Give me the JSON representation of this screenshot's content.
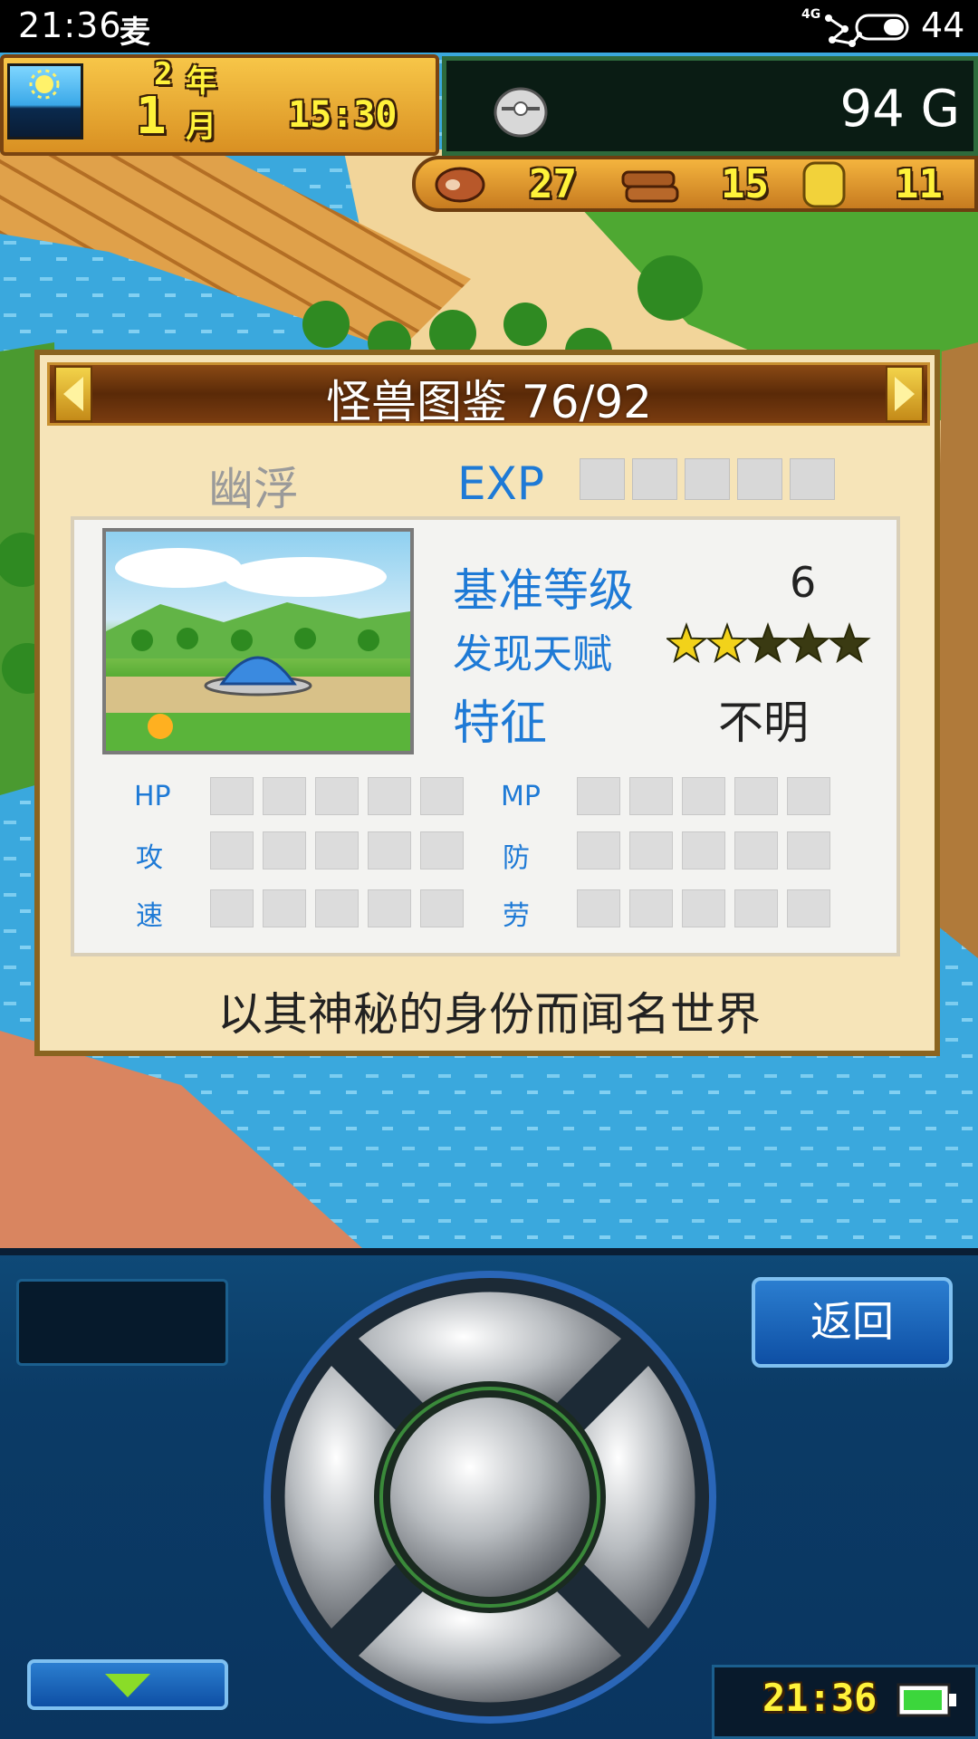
{
  "status_bar": {
    "time": "21:36",
    "app_badge": "麦",
    "network": "4G",
    "battery": "44"
  },
  "hud": {
    "year_num": "2",
    "year_unit": "年",
    "month_num": "1",
    "month_unit": "月",
    "clock": "15:30",
    "money": "94 G",
    "resources": [
      {
        "icon": "meat-icon",
        "value": "27"
      },
      {
        "icon": "wood-icon",
        "value": "15"
      },
      {
        "icon": "ore-icon",
        "value": "11"
      }
    ]
  },
  "dialog": {
    "title": "怪兽图鉴 76/92",
    "monster_name": "幽浮",
    "exp_label": "EXP",
    "exp_level": 0,
    "exp_max": 5,
    "base_level_label": "基准等级",
    "base_level_value": "6",
    "talent_label": "发现天赋",
    "talent_stars": 2,
    "talent_max": 5,
    "trait_label": "特征",
    "trait_value": "不明",
    "stats": [
      {
        "label": "HP",
        "value": 0
      },
      {
        "label": "MP",
        "value": 0
      },
      {
        "label": "攻",
        "value": 0
      },
      {
        "label": "防",
        "value": 0
      },
      {
        "label": "速",
        "value": 0
      },
      {
        "label": "劳",
        "value": 0
      }
    ],
    "description": "以其神秘的身份而闻名世界"
  },
  "controller": {
    "back_label": "返回",
    "clock": "21:36"
  },
  "colors": {
    "accent_blue": "#1e7ad6",
    "gold_text": "#fff23a",
    "panel_bg": "#f6e4b8",
    "controller_bg": "#0b3b66"
  }
}
